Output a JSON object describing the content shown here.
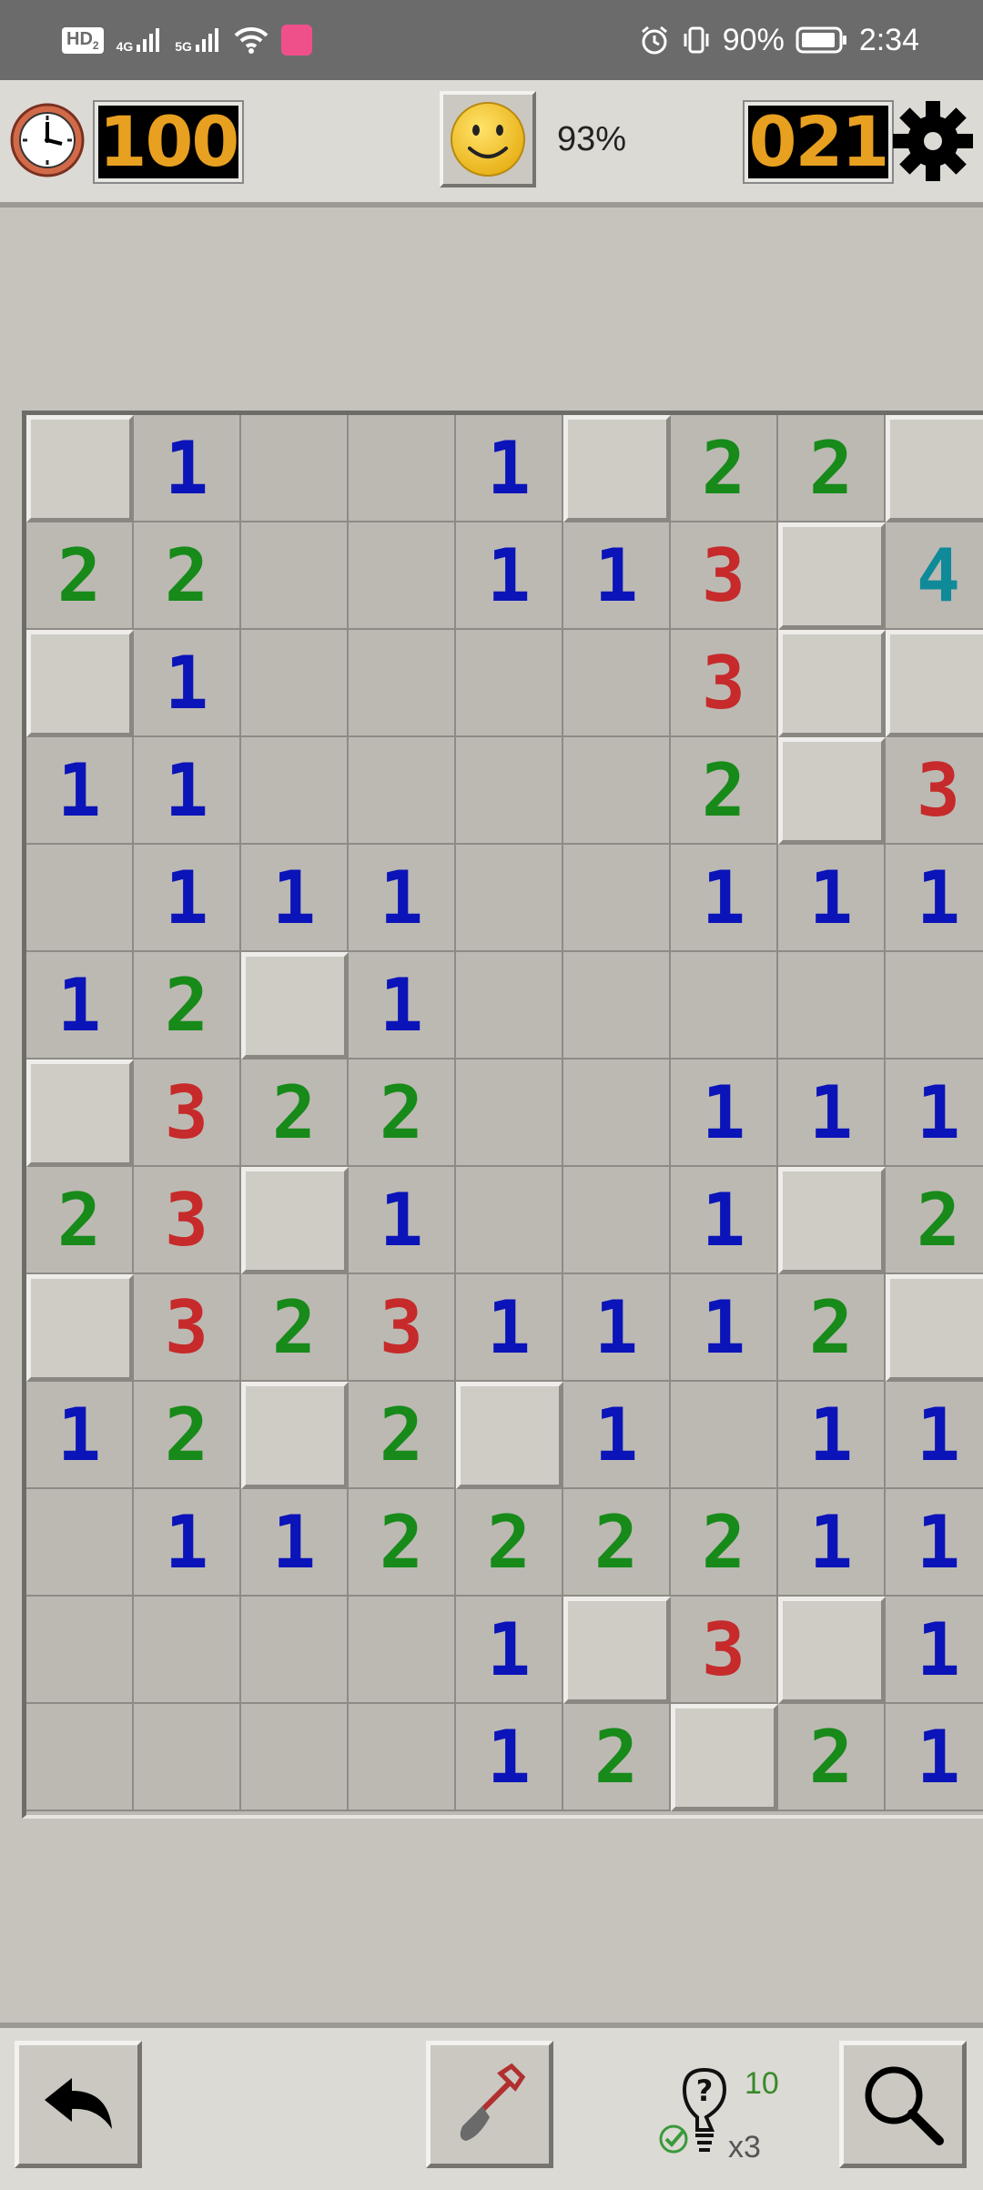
{
  "status_bar": {
    "hd_label": "HD",
    "hd_sub": "2",
    "signal1_label": "4G",
    "signal2_label": "5G",
    "battery": "90%",
    "time": "2:34",
    "icons": [
      "wifi-icon",
      "app-badge-icon",
      "alarm-icon",
      "vibrate-icon",
      "battery-icon"
    ]
  },
  "game": {
    "timer": "100",
    "progress": "93%",
    "mines_left": "021"
  },
  "board": {
    "cols": 9,
    "rows": [
      [
        "C",
        "1",
        "",
        "",
        "1",
        "C",
        "2",
        "2",
        "C"
      ],
      [
        "2",
        "2",
        "",
        "",
        "1",
        "1",
        "3",
        "C",
        "4"
      ],
      [
        "C",
        "1",
        "",
        "",
        "",
        "",
        "3",
        "C",
        "C"
      ],
      [
        "1",
        "1",
        "",
        "",
        "",
        "",
        "2",
        "C",
        "3"
      ],
      [
        "",
        "1",
        "1",
        "1",
        "",
        "",
        "1",
        "1",
        "1"
      ],
      [
        "1",
        "2",
        "C",
        "1",
        "",
        "",
        "",
        "",
        ""
      ],
      [
        "C",
        "3",
        "2",
        "2",
        "",
        "",
        "1",
        "1",
        "1"
      ],
      [
        "2",
        "3",
        "C",
        "1",
        "",
        "",
        "1",
        "C",
        "2"
      ],
      [
        "C",
        "3",
        "2",
        "3",
        "1",
        "1",
        "1",
        "2",
        "C"
      ],
      [
        "1",
        "2",
        "C",
        "2",
        "C",
        "1",
        "",
        "1",
        "1"
      ],
      [
        "",
        "1",
        "1",
        "2",
        "2",
        "2",
        "2",
        "1",
        "1"
      ],
      [
        "",
        "",
        "",
        "",
        "1",
        "C",
        "3",
        "C",
        "1"
      ],
      [
        "",
        "",
        "",
        "",
        "1",
        "2",
        "C",
        "2",
        "1"
      ]
    ]
  },
  "toolbar": {
    "hint_count": "10",
    "hint_multiplier": "x3",
    "hint_mark": "?"
  },
  "colors": {
    "n1": "#0a14b8",
    "n2": "#178a19",
    "n3": "#c62a2a",
    "n4": "#0f8a98",
    "led": "#e8a020"
  }
}
